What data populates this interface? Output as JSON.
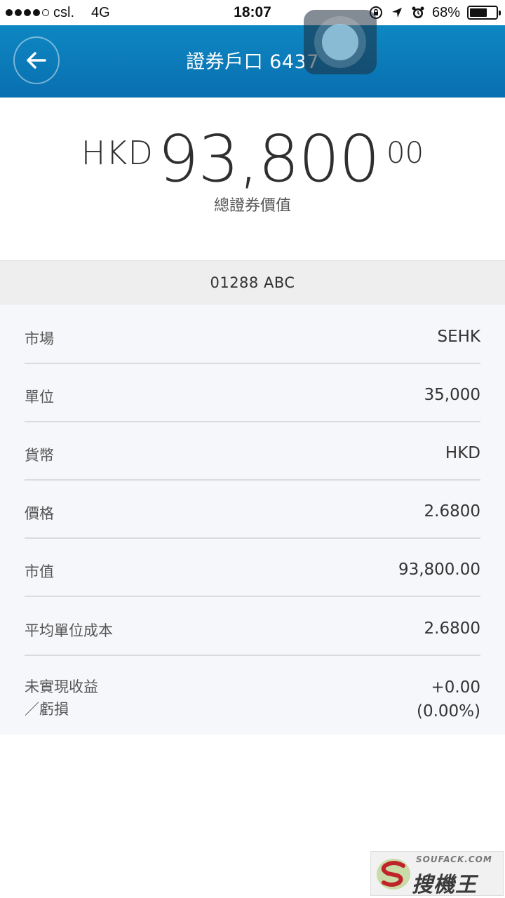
{
  "status_bar": {
    "carrier": "csl.",
    "network": "4G",
    "time": "18:07",
    "battery": "68%",
    "battery_level": 0.68,
    "icons": [
      "lock-rotation-icon",
      "location-arrow-icon",
      "alarm-icon",
      "battery-icon"
    ]
  },
  "header": {
    "title": "證券戶口 6437",
    "back_icon": "arrow-left-icon",
    "accent_color": "#0a7bbf"
  },
  "total": {
    "currency": "HKD",
    "amount_integer": "93,800",
    "amount_decimal": "00",
    "label": "總證券價值"
  },
  "stock": {
    "code_name": "01288 ABC"
  },
  "details": [
    {
      "label": "市場",
      "value": "SEHK"
    },
    {
      "label": "單位",
      "value": "35,000"
    },
    {
      "label": "貨幣",
      "value": "HKD"
    },
    {
      "label": "價格",
      "value": "2.6800"
    },
    {
      "label": "市值",
      "value": "93,800.00"
    },
    {
      "label": "平均單位成本",
      "value": "2.6800"
    },
    {
      "label_line1": "未實現收益",
      "label_line2": "／虧損",
      "value_line1": "+0.00",
      "value_line2": "(0.00%)"
    }
  ],
  "watermark": {
    "top_text": "SOUFACK.COM",
    "bottom_text": "搜機王"
  }
}
